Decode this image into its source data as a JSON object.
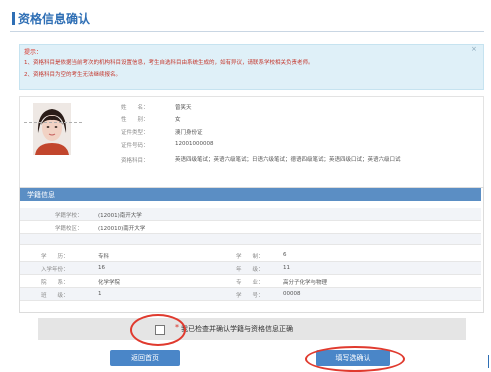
{
  "header": {
    "title": "资格信息确认"
  },
  "notice": {
    "label": "提示：",
    "close": "×",
    "lines": [
      "1、资格科目是依据当前考次的机构科目设置信息，考生自选科目由系统生成的，如有异议，请联系学校相关负责老师。",
      "2、资格科目为空的考生无法继续报名。"
    ]
  },
  "profile": {
    "fields": [
      {
        "label": "姓　　名：",
        "value": "曾笑天"
      },
      {
        "label": "性　　别：",
        "value": "女"
      },
      {
        "label": "证件类型：",
        "value": "澳门身份证"
      },
      {
        "label": "证件号码：",
        "value": "12001000008"
      },
      {
        "label": "资格科目：",
        "value": "英语四级笔试；英语六级笔试；日语六级笔试；德语四级笔试；英语四级口试；英语六级口试"
      }
    ]
  },
  "academic": {
    "title": "学籍信息",
    "school_label": "学籍学校：",
    "school_value": "(12001)南开大学",
    "campus_label": "学籍校区：",
    "campus_value": "(120010)南开大学",
    "rows": [
      {
        "l1": "学　　历：",
        "v1": "专科",
        "l2": "学　　制：",
        "v2": "6"
      },
      {
        "l1": "入学年份：",
        "v1": "16",
        "l2": "年　　级：",
        "v2": "11"
      },
      {
        "l1": "院　　系：",
        "v1": "化学学院",
        "l2": "专　　业：",
        "v2": "高分子化学与物理"
      },
      {
        "l1": "班　　级：",
        "v1": "1",
        "l2": "学　　号：",
        "v2": "00008"
      }
    ]
  },
  "confirm": {
    "asterisk": "*",
    "text": "我已检查并确认学籍与资格信息正确"
  },
  "buttons": {
    "back": "返回首页",
    "next": "填写选确认"
  },
  "colors": {
    "accent": "#2f6fb5",
    "section_header": "#5b8ec4",
    "button": "#4a86c8",
    "annotation": "#e03a2e"
  }
}
